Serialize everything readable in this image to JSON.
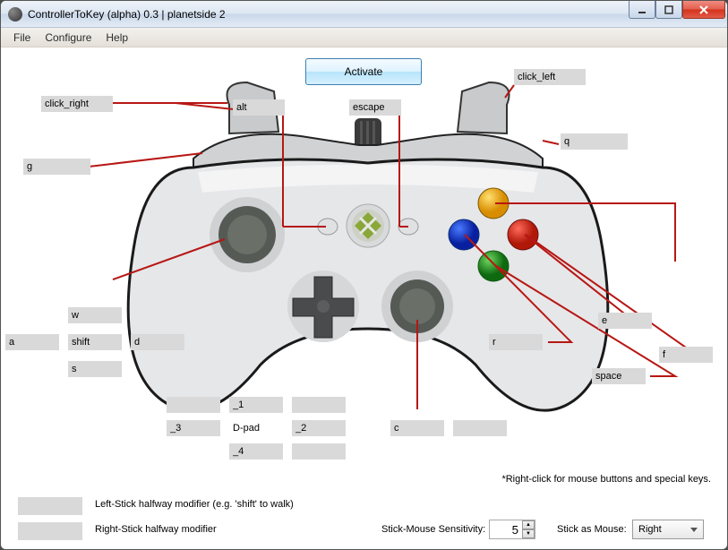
{
  "window": {
    "title": "ControllerToKey (alpha) 0.3 | planetside 2"
  },
  "menu": {
    "file": "File",
    "configure": "Configure",
    "help": "Help"
  },
  "activate_button": "Activate",
  "bindings": {
    "left_trigger": "click_right",
    "alt": "alt",
    "escape": "escape",
    "right_trigger": "click_left",
    "left_shoulder": "g",
    "right_shoulder": "q",
    "lstick_up": "w",
    "lstick_left": "a",
    "lstick_right": "d",
    "lstick_down": "s",
    "lstick_shift": "shift",
    "dpad_up": "_1",
    "dpad_left": "_3",
    "dpad_right": "_2",
    "dpad_down": "_4",
    "dpad_label": "D-pad",
    "dpad_upleft": "",
    "dpad_upright": "",
    "dpad_downright": "",
    "rstick_c": "c",
    "rstick_blank": "",
    "face_y": "",
    "face_b": "f",
    "face_a": "space",
    "face_x": "r",
    "face_e": "e"
  },
  "bottom": {
    "left_mod": "",
    "left_mod_label": "Left-Stick halfway modifier (e.g. 'shift' to walk)",
    "right_mod": "",
    "right_mod_label": "Right-Stick halfway modifier",
    "sens_label": "Stick-Mouse Sensitivity:",
    "sens_value": "5",
    "mouse_label": "Stick as Mouse:",
    "mouse_value": "Right",
    "hint": "*Right-click for mouse buttons and special keys."
  }
}
